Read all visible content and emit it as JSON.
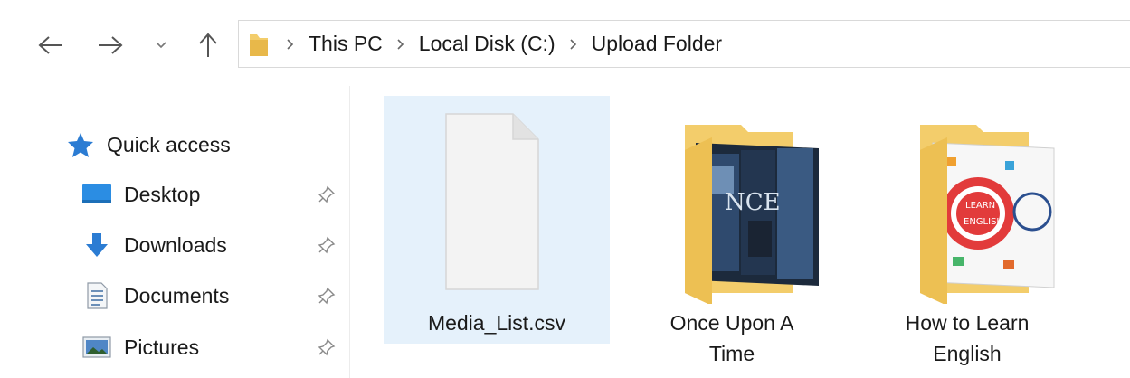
{
  "navigation": {
    "back_icon": "arrow-left-icon",
    "forward_icon": "arrow-right-icon",
    "recent_icon": "chevron-down-icon",
    "up_icon": "arrow-up-icon"
  },
  "address_bar": {
    "folder_icon": "folder-icon",
    "separator_icon": "chevron-right-icon",
    "breadcrumbs": [
      "This PC",
      "Local Disk (C:)",
      "Upload Folder"
    ]
  },
  "sidebar": {
    "items": [
      {
        "label": "Quick access",
        "icon": "star-icon",
        "pinned": false
      },
      {
        "label": "Desktop",
        "icon": "desktop-icon",
        "pinned": true
      },
      {
        "label": "Downloads",
        "icon": "download-arrow-icon",
        "pinned": true
      },
      {
        "label": "Documents",
        "icon": "document-icon",
        "pinned": true
      },
      {
        "label": "Pictures",
        "icon": "picture-icon",
        "pinned": true
      }
    ],
    "pin_icon": "pin-icon"
  },
  "files": [
    {
      "name": "Media_List.csv",
      "type": "file",
      "icon": "blank-file-icon",
      "selected": true
    },
    {
      "name_lines": [
        "Once Upon A",
        "Time"
      ],
      "type": "folder",
      "icon": "folder-with-preview-icon",
      "selected": false
    },
    {
      "name_lines": [
        "How to Learn",
        "English"
      ],
      "type": "folder",
      "icon": "folder-with-preview-icon",
      "selected": false
    }
  ],
  "colors": {
    "selection": "#e5f1fb",
    "folder_yellow": "#f3cd6b",
    "accent_blue": "#2b7cd3",
    "text": "#1a1a1a"
  }
}
